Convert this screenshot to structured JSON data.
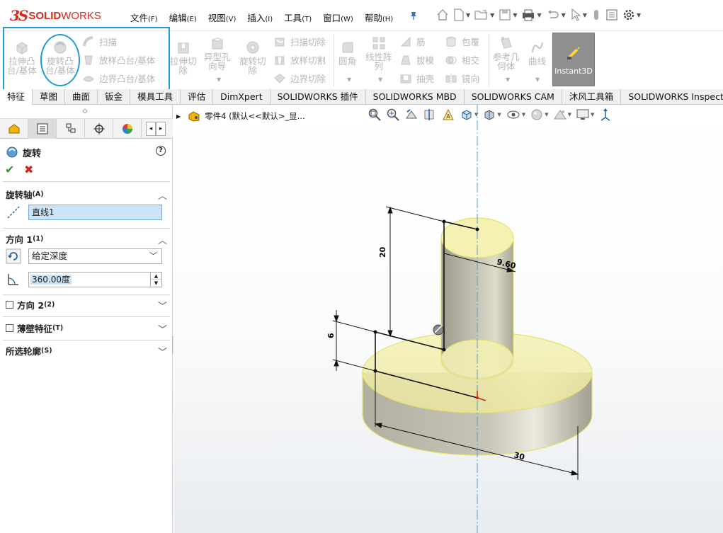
{
  "app": {
    "logo_prefix": "3S",
    "logo_brand_bold": "SOLID",
    "logo_brand_light": "WORKS"
  },
  "menus": [
    {
      "label": "文件",
      "key": "(F)"
    },
    {
      "label": "编辑",
      "key": "(E)"
    },
    {
      "label": "视图",
      "key": "(V)"
    },
    {
      "label": "插入",
      "key": "(I)"
    },
    {
      "label": "工具",
      "key": "(T)"
    },
    {
      "label": "窗口",
      "key": "(W)"
    },
    {
      "label": "帮助",
      "key": "(H)"
    }
  ],
  "quick_access_icons": [
    "home-icon",
    "new-document-icon",
    "open-folder-icon",
    "save-icon",
    "print-icon",
    "undo-icon",
    "select-pointer-icon",
    "rebuild-traffic-light-icon",
    "file-properties-icon",
    "options-gear-icon"
  ],
  "commands": {
    "extrude_boss": "拉伸凸台/基体",
    "extrude_boss_l1": "拉伸凸",
    "extrude_boss_l2": "台/基体",
    "revolve_boss_l1": "旋转凸",
    "revolve_boss_l2": "台/基体",
    "sweep": "扫描",
    "loft": "放样凸台/基体",
    "boundary": "边界凸台/基体",
    "extrude_cut_l1": "拉伸切",
    "extrude_cut_l2": "除",
    "hole_wizard_l1": "异型孔",
    "hole_wizard_l2": "向导",
    "revolve_cut_l1": "旋转切",
    "revolve_cut_l2": "除",
    "sweep_cut": "扫描切除",
    "loft_cut": "放样切割",
    "boundary_cut": "边界切除",
    "fillet": "圆角",
    "linear_pattern_l1": "线性阵",
    "linear_pattern_l2": "列",
    "rib": "筋",
    "draft": "拔模",
    "shell": "抽壳",
    "wrap": "包覆",
    "intersect": "相交",
    "mirror": "镜向",
    "ref_geom_l1": "参考几",
    "ref_geom_l2": "何体",
    "curves": "曲线",
    "instant3d": "Instant3D"
  },
  "tabs": [
    "特征",
    "草图",
    "曲面",
    "钣金",
    "模具工具",
    "评估",
    "DimXpert",
    "SOLIDWORKS 插件",
    "SOLIDWORKS MBD",
    "SOLIDWORKS CAM",
    "沐风工具箱",
    "SOLIDWORKS Inspection"
  ],
  "property_manager": {
    "title": "旋转",
    "help": "?",
    "ok": "✔",
    "cancel": "✖",
    "axis_section": {
      "label": "旋转轴",
      "key": "(A)",
      "value": "直线1"
    },
    "direction1": {
      "label": "方向 1",
      "key": "(1)",
      "end_condition": "给定深度",
      "angle": "360.00度"
    },
    "direction2": {
      "label": "方向 2",
      "key": "(2)"
    },
    "thin_feature": {
      "label": "薄壁特征",
      "key": "(T)"
    },
    "selected_contours": {
      "label": "所选轮廓",
      "key": "(S)"
    }
  },
  "feature_tree": {
    "node_label": "零件4  (默认<<默认>_显..."
  },
  "dimensions": {
    "height": "20",
    "radius_top": "9.60",
    "flange_thickness": "6",
    "flange_radius": "30"
  },
  "colors": {
    "brand_red": "#d52b1e",
    "highlight_blue": "#1e9ad6",
    "preview_yellow": "#f3efaa",
    "ok_green": "#2e9b2e",
    "cancel_red": "#d32020"
  }
}
